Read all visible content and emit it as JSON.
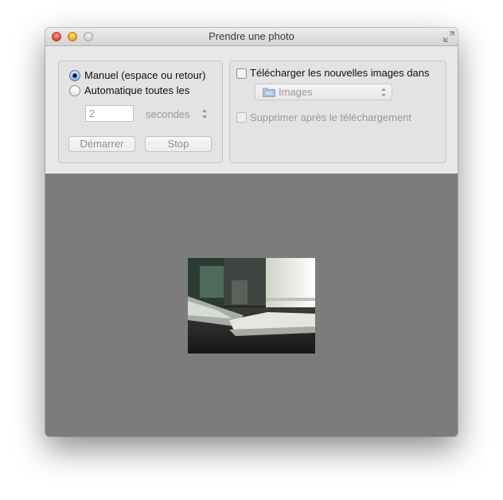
{
  "window": {
    "title": "Prendre une photo"
  },
  "capture_mode": {
    "options": [
      {
        "label": "Manuel (espace ou retour)",
        "selected": true
      },
      {
        "label": "Automatique toutes les",
        "selected": false
      }
    ],
    "interval_value": "2",
    "interval_unit": "secondes",
    "start_button": "Démarrer",
    "stop_button": "Stop"
  },
  "download": {
    "checkbox_label": "Télécharger les nouvelles images dans",
    "checked": false,
    "destination": "Images",
    "delete_label": "Supprimer après le téléchargement",
    "delete_checked": false
  },
  "colors": {
    "panel_background": "#e8e8e8",
    "preview_background": "#7c7c7c",
    "disabled_text": "#9a9a9a"
  },
  "icons": {
    "fullscreen": "fullscreen-arrows-icon",
    "folder": "folder-icon",
    "stepper": "stepper-arrows-icon",
    "popup_arrows": "up-down-arrows-icon"
  }
}
